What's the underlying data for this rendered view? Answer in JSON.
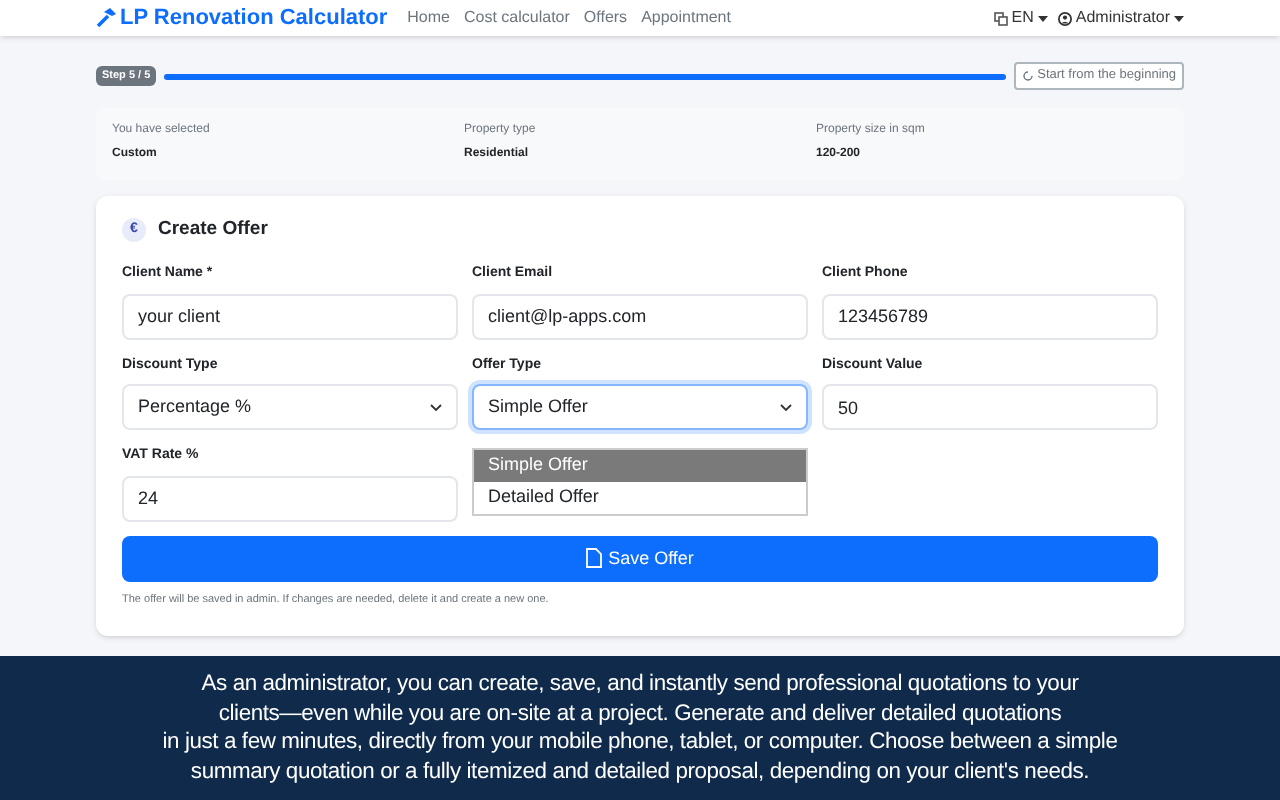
{
  "navbar": {
    "brand": "LP Renovation Calculator",
    "links": [
      {
        "label": "Home"
      },
      {
        "label": "Cost calculator"
      },
      {
        "label": "Offers"
      },
      {
        "label": "Appointment"
      }
    ],
    "language": "EN",
    "user": "Administrator"
  },
  "progress": {
    "step": "Step 5 / 5",
    "level": 1,
    "restart": "Start from the beginning"
  },
  "summary": [
    {
      "label": "You have selected",
      "value": "Custom"
    },
    {
      "label": "Property type",
      "value": "Residential"
    },
    {
      "label": "Property size in sqm",
      "value": "120-200"
    }
  ],
  "form": {
    "icon_text": "€",
    "title": "Create Offer",
    "fields": [
      {
        "kind": "text",
        "label": "Client Name *",
        "value": "your client"
      },
      {
        "kind": "text",
        "label": "Client Email",
        "value": "client@lp-apps.com"
      },
      {
        "kind": "text",
        "label": "Client Phone",
        "value": "123456789"
      },
      {
        "kind": "select",
        "label": "Discount Type",
        "value": "Percentage %",
        "focused": false
      },
      {
        "kind": "select",
        "label": "Offer Type",
        "value": "Simple Offer",
        "focused": true,
        "options": [
          {
            "label": "Simple Offer",
            "selected": true
          },
          {
            "label": "Detailed Offer",
            "selected": false
          }
        ]
      },
      {
        "kind": "text",
        "label": "Discount Value",
        "value": "50"
      },
      {
        "kind": "text",
        "label": "VAT Rate %",
        "value": "24"
      }
    ],
    "save_button": "Save Offer",
    "note": "The offer will be saved in admin. If changes are needed, delete it and create a new one."
  },
  "caption": [
    "As an administrator, you can create, save, and instantly send professional quotations to your",
    "clients—even while you are on-site at a project. Generate and deliver detailed quotations",
    "in just a few minutes, directly from your mobile phone, tablet, or computer. Choose between a simple",
    "summary quotation or a fully itemized and detailed proposal, depending on your client's needs."
  ]
}
